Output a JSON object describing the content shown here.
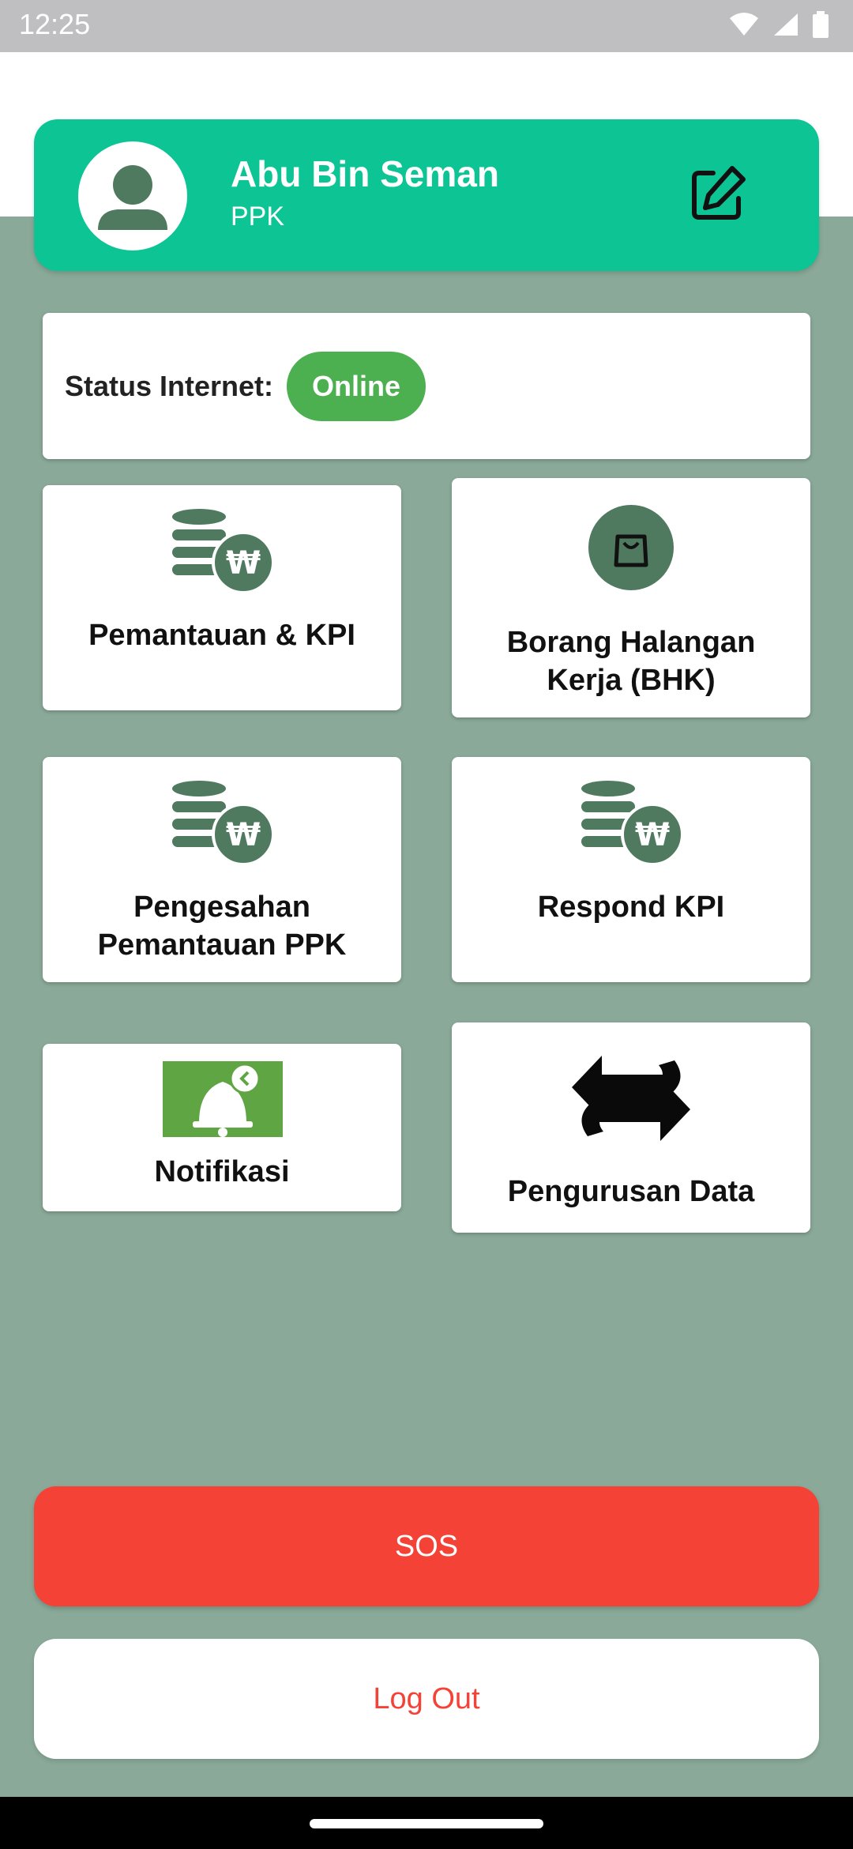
{
  "status_bar": {
    "time": "12:25"
  },
  "profile": {
    "name": "Abu Bin Seman",
    "role": "PPK"
  },
  "internet": {
    "label": "Status Internet:",
    "status": "Online"
  },
  "menu": {
    "pemantauan": "Pemantauan & KPI",
    "bhk_line1": "Borang Halangan",
    "bhk_line2": "Kerja (BHK)",
    "pengesahan_line1": "Pengesahan",
    "pengesahan_line2": "Pemantauan PPK",
    "respond": "Respond KPI",
    "notifikasi": "Notifikasi",
    "pengurusan": "Pengurusan Data"
  },
  "buttons": {
    "sos": "SOS",
    "logout": "Log Out"
  },
  "icons": {
    "money_stack": "coins-won-icon",
    "bag": "shopping-bag-icon",
    "bell": "notification-bell-icon",
    "sync": "sync-arrows-icon",
    "edit": "edit-icon",
    "avatar": "user-avatar-icon"
  },
  "colors": {
    "accent": "#0cc494",
    "background": "#8aa998",
    "online": "#4caf50",
    "sos": "#f44336"
  }
}
